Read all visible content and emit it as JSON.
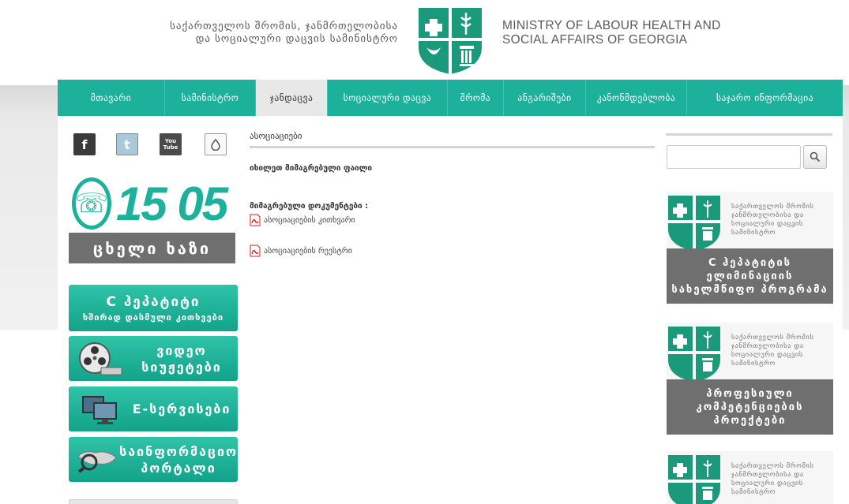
{
  "header": {
    "ge_title_line1": "საქართველოს შრომის, ჯანმრთელობისა",
    "ge_title_line2": "და სოციალური დაცვის სამინისტრო",
    "en_title_line1": "MINISTRY OF LABOUR HEALTH AND",
    "en_title_line2": "SOCIAL AFFAIRS OF GEORGIA"
  },
  "nav": {
    "items": [
      {
        "label": "მთავარი"
      },
      {
        "label": "სამინისტრო"
      },
      {
        "label": "ჯანდაცვა"
      },
      {
        "label": "სოციალური დაცვა"
      },
      {
        "label": "შრომა"
      },
      {
        "label": "ანგარიშები"
      },
      {
        "label": "კანონმდებლობა"
      },
      {
        "label": "საჯარო ინფორმაცია"
      }
    ],
    "active_index": 2
  },
  "social": {
    "facebook": "f",
    "twitter": "t",
    "youtube_line1": "You",
    "youtube_line2": "Tube"
  },
  "hotline": {
    "number": "15 05",
    "label": "ცხელი ხაზი"
  },
  "left_buttons": {
    "hepatitis_line1": "C ჰეპატიტი",
    "hepatitis_line2": "ხშირად დასმული კითხვები",
    "video_line1": "ვიდეო",
    "video_line2": "სიუჟეტები",
    "eservices": "E-სერვისები",
    "portal_line1": "საინფორმაციო",
    "portal_line2": "პორტალი"
  },
  "main": {
    "section_title": "ასოციაციები",
    "view_file": "იხილეთ მიმაგრებული ფაილი",
    "attached_docs": "მიმაგრებული დოკუმენტები :",
    "documents": [
      {
        "label": "ასოციაციების კითხვარი"
      },
      {
        "label": "ასოციაციების რეესტრი"
      }
    ]
  },
  "right": {
    "search_placeholder": "",
    "banners": [
      {
        "ministry_text": "საქართველოს შრომის ჯანმრთელობისა და სოციალური დაცვის სამინისტრო",
        "strip": "C ჰეპატიტის ელიმინაციის სახელმწიფო პროგრამა"
      },
      {
        "ministry_text": "საქართველოს შრომის ჯანმრთელობისა და სოციალური დაცვის სამინისტრო",
        "strip": "პროფესიული კომპეტენციების პროექტები"
      },
      {
        "ministry_text": "საქართველოს შრომის ჯანმრთელობისა და სოციალური დაცვის სამინისტრო",
        "strip": ""
      }
    ]
  },
  "colors": {
    "brand_green": "#1db19c",
    "dark_grey": "#6f6f6f",
    "nav_active": "#e8e8e8"
  }
}
